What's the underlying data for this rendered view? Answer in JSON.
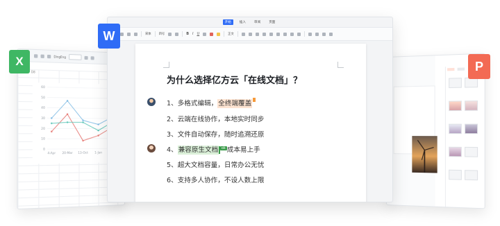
{
  "apps": {
    "sheet_badge": "X",
    "writer_badge": "W",
    "slides_badge": "P"
  },
  "colors": {
    "sheet": "#3fb764",
    "writer": "#2f6cf6",
    "slides": "#f36a54",
    "line_blue": "#7fbbe4",
    "line_red": "#e67a75",
    "line_teal": "#5fc6b8"
  },
  "writer": {
    "menu_tabs": [
      "开始",
      "插入",
      "审阅",
      "页面"
    ],
    "toolbar_font": "宋体",
    "toolbar_size": "四号",
    "toolbar_style": "正文",
    "title": "为什么选择亿方云「在线文档」？",
    "lines": [
      {
        "prefix": "1、多格式编辑，",
        "highlight": "全终端覆盖",
        "suffix": ""
      },
      {
        "text": "2、云端在线协作，本地实时同步"
      },
      {
        "text": "3、文件自动保存，随时追溯还原"
      },
      {
        "prefix": "4、",
        "highlight": "兼容原生文档",
        "tag": "ok",
        "suffix": "成本易上手"
      },
      {
        "text": "5、超大文档容量，日常办公无忧"
      },
      {
        "text": "6、支持多人协作，不设人数上限"
      }
    ]
  },
  "sheet": {
    "cell_ref": "D8",
    "toolbar_font": "DingEng"
  },
  "chart_data": {
    "type": "line",
    "x": [
      "4-Apr",
      "20-Mar",
      "13-Oct",
      "1-Jan",
      "21-Oct"
    ],
    "ylim": [
      0,
      60
    ],
    "yticks": [
      0,
      10,
      20,
      30,
      40,
      50,
      60
    ],
    "series": [
      {
        "values": [
          30,
          47,
          28,
          24,
          32
        ]
      },
      {
        "values": [
          17,
          34,
          8,
          13,
          22
        ]
      },
      {
        "values": [
          25,
          26,
          26,
          18,
          27
        ]
      }
    ]
  }
}
